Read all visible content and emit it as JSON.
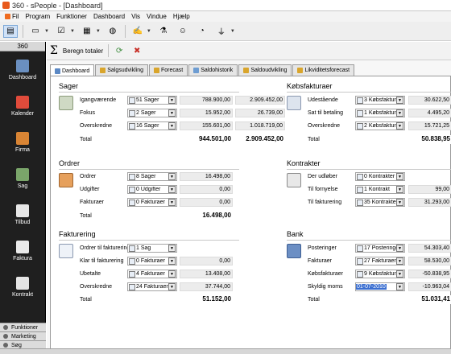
{
  "window": {
    "title": "360 - sPeople - [Dashboard]"
  },
  "menu": [
    "Fil",
    "Program",
    "Funktioner",
    "Dashboard",
    "Vis",
    "Vindue",
    "Hjælp"
  ],
  "sidebar": {
    "header": "360",
    "items": [
      "Dashboard",
      "Kalender",
      "Firma",
      "Sag",
      "Tilbud",
      "Faktura",
      "Kontrakt"
    ],
    "bottom": [
      "Funktioner",
      "Marketing",
      "Søg"
    ]
  },
  "content_toolbar": {
    "totals_button": "Beregn totaler"
  },
  "tabs": [
    "Dashboard",
    "Salgsudvikling",
    "Forecast",
    "Saldohistorik",
    "Saldoudvikling",
    "Likviditetsforecast"
  ],
  "sections": {
    "sager": {
      "title": "Sager",
      "rows": [
        {
          "label": "Igangværende",
          "dropdown": "51 Sager",
          "v1": "788.900,00",
          "v2": "2.909.452,00"
        },
        {
          "label": "Fokus",
          "dropdown": "2 Sager",
          "v1": "15.952,00",
          "v2": "26.739,00"
        },
        {
          "label": "Overskredne",
          "dropdown": "16 Sager",
          "v1": "155.601,00",
          "v2": "1.018.719,00"
        }
      ],
      "total_label": "Total",
      "total1": "944.501,00",
      "total2": "2.909.452,00"
    },
    "ordrer": {
      "title": "Ordrer",
      "rows": [
        {
          "label": "Ordrer",
          "dropdown": "8 Sager",
          "v1": "16.498,00"
        },
        {
          "label": "Udgifter",
          "dropdown": "0 Udgifter",
          "v1": "0,00"
        },
        {
          "label": "Fakturaer",
          "dropdown": "0 Fakturaer",
          "v1": "0,00"
        }
      ],
      "total_label": "Total",
      "total1": "16.498,00"
    },
    "fakturering": {
      "title": "Fakturering",
      "rows": [
        {
          "label": "Ordrer til fakturering",
          "dropdown": "1 Sag",
          "v1": ""
        },
        {
          "label": "Klar til fakturering",
          "dropdown": "0 Fakturaer",
          "v1": "0,00"
        },
        {
          "label": "Ubetalte",
          "dropdown": "4 Fakturaer",
          "v1": "13.408,00"
        },
        {
          "label": "Overskredne",
          "dropdown": "24 Fakturaer",
          "v1": "37.744,00"
        }
      ],
      "total_label": "Total",
      "total1": "51.152,00"
    },
    "kobsfakturaer": {
      "title": "Købsfakturaer",
      "rows": [
        {
          "label": "Udestående",
          "dropdown": "3 Købsfaktur",
          "v1": "30.622,50"
        },
        {
          "label": "Sat til betaling",
          "dropdown": "1 Købsfaktur",
          "v1": "4.495,20"
        },
        {
          "label": "Overskredne",
          "dropdown": "2 Købsfaktur",
          "v1": "15.721,25"
        }
      ],
      "total_label": "Total",
      "total1": "50.838,95"
    },
    "kontrakter": {
      "title": "Kontrakter",
      "rows": [
        {
          "label": "Der udløber",
          "dropdown": "0 Kontrakter",
          "v1": ""
        },
        {
          "label": "Til fornyelse",
          "dropdown": "1 Kontrakt",
          "v1": "99,00"
        },
        {
          "label": "Til fakturering",
          "dropdown": "35 Kontrakte",
          "v1": "31.293,00"
        }
      ]
    },
    "bank": {
      "title": "Bank",
      "rows": [
        {
          "label": "Posteringer",
          "dropdown": "17 Posteringe",
          "v1": "54.303,40"
        },
        {
          "label": "Fakturaer",
          "dropdown": "27 Fakturaer",
          "v1": "58.530,00"
        },
        {
          "label": "Købsfakturaer",
          "dropdown": "9 Købsfaktur",
          "v1": "-50.838,95"
        },
        {
          "label": "Skyldig moms",
          "dropdown": "01-07-2010",
          "v1": "-10.963,04"
        }
      ],
      "total_label": "Total",
      "total1": "51.031,41"
    }
  }
}
